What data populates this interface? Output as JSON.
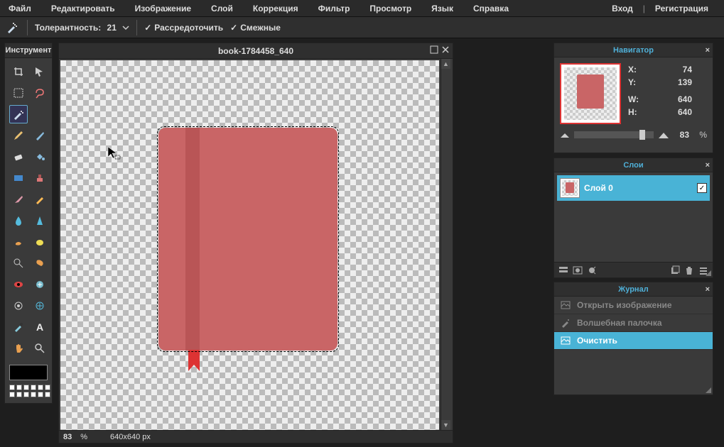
{
  "menubar": {
    "items": [
      "Файл",
      "Редактировать",
      "Изображение",
      "Слой",
      "Коррекция",
      "Фильтр",
      "Просмотр",
      "Язык",
      "Справка"
    ],
    "login": "Вход",
    "register": "Регистрация"
  },
  "options": {
    "tolerance_label": "Толерантность:",
    "tolerance_value": "21",
    "anti_alias": "Рассредоточить",
    "contiguous": "Смежные"
  },
  "toolbox": {
    "title": "Инструмент"
  },
  "document": {
    "title": "book-1784458_640",
    "zoom": "83",
    "zoom_unit": "%",
    "dimensions": "640x640 px"
  },
  "navigator": {
    "title": "Навигатор",
    "x_label": "X:",
    "y_label": "Y:",
    "w_label": "W:",
    "h_label": "H:",
    "x": "74",
    "y": "139",
    "w": "640",
    "h": "640",
    "zoom": "83",
    "zoom_unit": "%"
  },
  "layers": {
    "title": "Слои",
    "layer0": "Слой 0"
  },
  "history": {
    "title": "Журнал",
    "items": [
      "Открыть изображение",
      "Волшебная палочка",
      "Очистить"
    ]
  }
}
